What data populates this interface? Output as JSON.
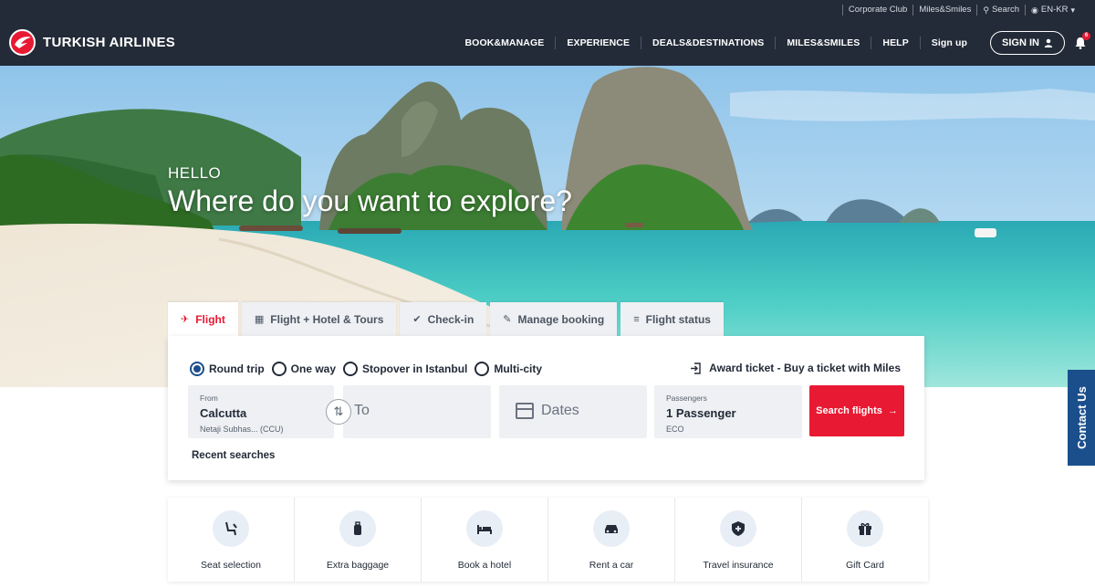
{
  "topbar": {
    "links": [
      "Corporate Club",
      "Miles&Smiles",
      "Search",
      "EN-KR"
    ]
  },
  "nav": {
    "brand": "TURKISH AIRLINES",
    "items": [
      "BOOK&MANAGE",
      "EXPERIENCE",
      "DEALS&DESTINATIONS",
      "MILES&SMILES",
      "HELP",
      "Sign up"
    ],
    "signin": "SIGN IN",
    "notification_count": "6"
  },
  "hero": {
    "greeting": "HELLO",
    "headline": "Where do you want to explore?"
  },
  "booking": {
    "tabs": [
      "Flight",
      "Flight + Hotel & Tours",
      "Check-in",
      "Manage booking",
      "Flight status"
    ],
    "active_tab": "Flight",
    "trip_types": [
      "Round trip",
      "One way",
      "Stopover in Istanbul",
      "Multi-city"
    ],
    "selected_trip_type": "Round trip",
    "award": "Award ticket - Buy a ticket with Miles",
    "from": {
      "label": "From",
      "value": "Calcutta",
      "sub": "Netaji Subhas...  (CCU)"
    },
    "to": {
      "placeholder": "To"
    },
    "dates": {
      "placeholder": "Dates"
    },
    "passengers": {
      "label": "Passengers",
      "value": "1 Passenger",
      "cabin": "ECO"
    },
    "search_button": "Search flights",
    "recent": "Recent searches"
  },
  "services": [
    "Seat selection",
    "Extra baggage",
    "Book a hotel",
    "Rent a car",
    "Travel insurance",
    "Gift Card"
  ],
  "contact": "Contact Us",
  "colors": {
    "brand_red": "#e81932",
    "navy": "#232b38",
    "blue": "#1b4f8c"
  }
}
